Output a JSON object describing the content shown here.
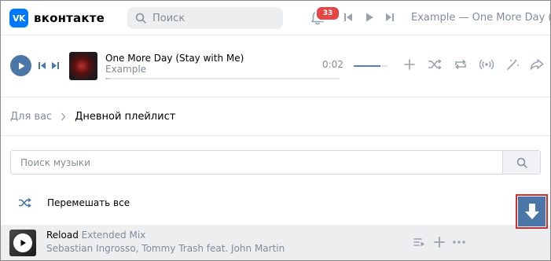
{
  "header": {
    "logo_mark": "VK",
    "logo_text": "вконтакте",
    "search_placeholder": "Поиск",
    "notifications_count": "33",
    "now_playing": "Example — One More Day (Stay"
  },
  "player": {
    "title": "One More Day (Stay with Me)",
    "artist": "Example",
    "time": "0:02",
    "progress": 0.02,
    "volume": 0.8
  },
  "breadcrumb": {
    "parent": "Для вас",
    "current": "Дневной плейлист"
  },
  "music_search": {
    "placeholder": "Поиск музыки"
  },
  "shuffle_label": "Перемешать все",
  "tracks": [
    {
      "title": "Reload",
      "subtitle": "Extended Mix",
      "artist": "Sebastian Ingrosso, Tommy Trash feat. John Martin"
    }
  ],
  "colors": {
    "accent": "#4a76a8",
    "badge": "#e64646",
    "highlight_border": "#d92a2a",
    "logo": "#0077ff"
  }
}
